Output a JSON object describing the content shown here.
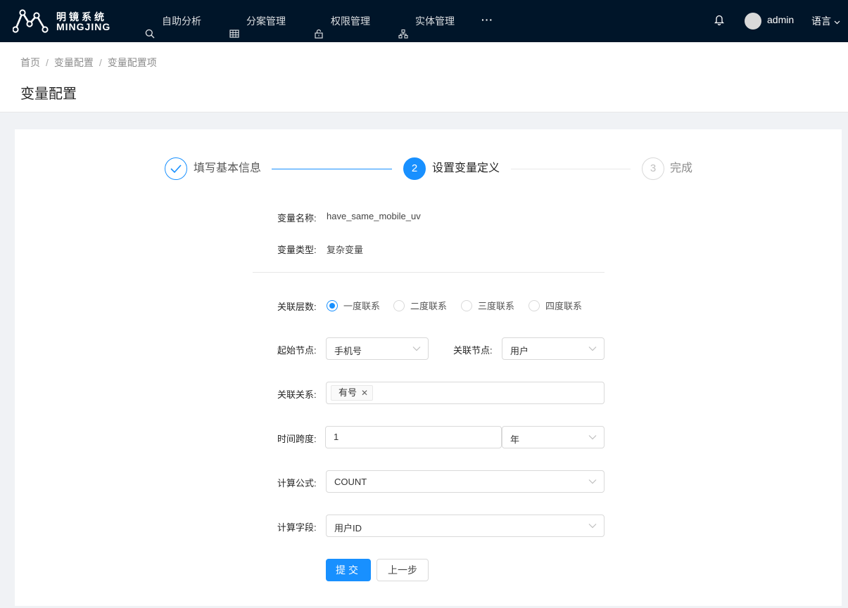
{
  "header": {
    "brand_cn": "明镜系统",
    "brand_en": "MINGJING",
    "nav": [
      {
        "label": "自助分析",
        "icon": "search-icon"
      },
      {
        "label": "分案管理",
        "icon": "table-icon"
      },
      {
        "label": "权限管理",
        "icon": "lock-icon"
      },
      {
        "label": "实体管理",
        "icon": "hierarchy-icon"
      }
    ],
    "more": "···",
    "username": "admin",
    "language": "语言"
  },
  "breadcrumb": [
    "首页",
    "变量配置",
    "变量配置项"
  ],
  "page_title": "变量配置",
  "steps": [
    {
      "label": "填写基本信息",
      "status": "finished"
    },
    {
      "num": "2",
      "label": "设置变量定义",
      "status": "active"
    },
    {
      "num": "3",
      "label": "完成",
      "status": "wait"
    }
  ],
  "form": {
    "var_name_label": "变量名称:",
    "var_name_value": "have_same_mobile_uv",
    "var_type_label": "变量类型:",
    "var_type_value": "复杂变量",
    "relation_level_label": "关联层数:",
    "relation_levels": [
      "一度联系",
      "二度联系",
      "三度联系",
      "四度联系"
    ],
    "start_node_label": "起始节点:",
    "start_node_value": "手机号",
    "related_node_label": "关联节点:",
    "related_node_value": "用户",
    "relation_label": "关联关系:",
    "relation_tag": "有号",
    "time_span_label": "时间跨度:",
    "time_span_value": "1",
    "time_unit_value": "年",
    "formula_label": "计算公式:",
    "formula_value": "COUNT",
    "field_label": "计算字段:",
    "field_value": "用户ID",
    "submit": "提交",
    "prev": "上一步"
  },
  "colors": {
    "primary": "#1890ff",
    "header_bg": "#001529"
  }
}
